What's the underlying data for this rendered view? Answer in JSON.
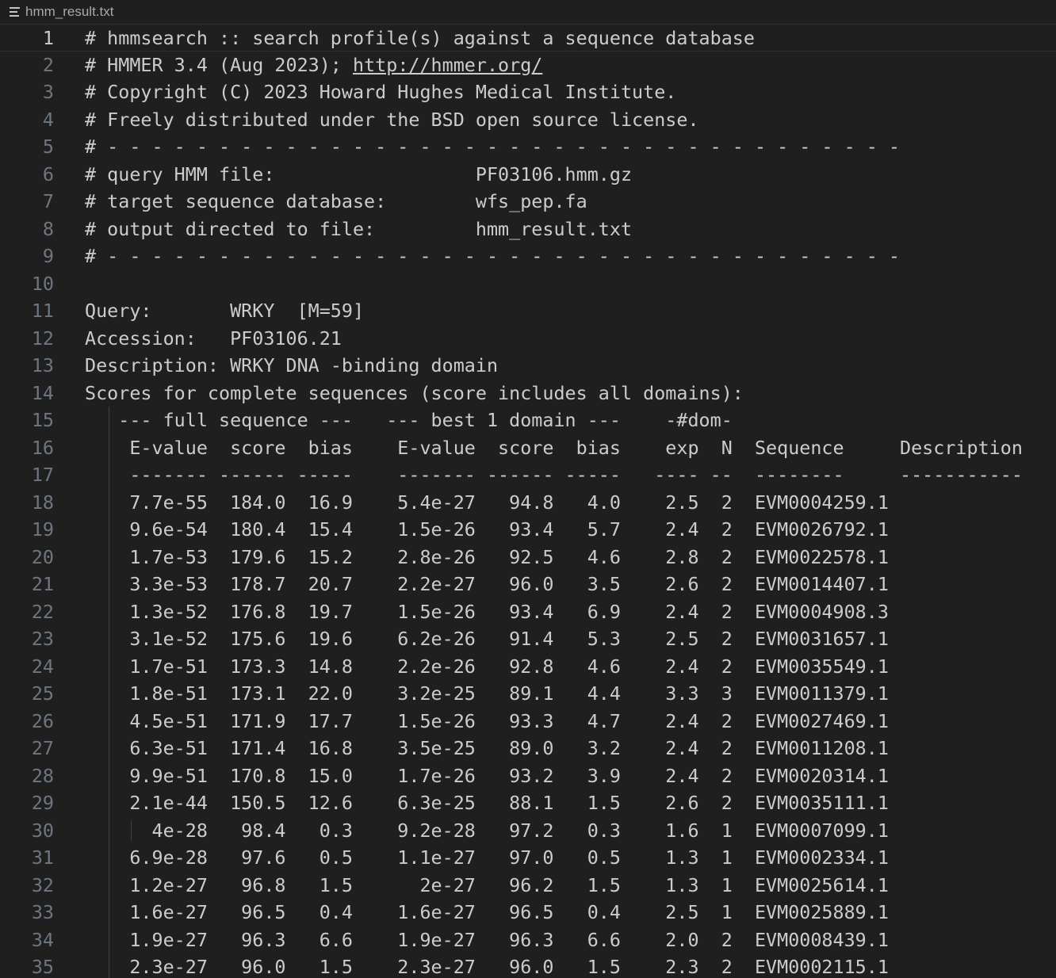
{
  "tab": {
    "filename": "hmm_result.txt",
    "icon": "file-text-icon"
  },
  "editor": {
    "current_line": 1,
    "link_text": "http://hmmer.org/",
    "lines": [
      {
        "n": "1",
        "text": "# hmmsearch :: search profile(s) against a sequence database"
      },
      {
        "n": "2",
        "text": "# HMMER 3.4 (Aug 2023); "
      },
      {
        "n": "3",
        "text": "# Copyright (C) 2023 Howard Hughes Medical Institute."
      },
      {
        "n": "4",
        "text": "# Freely distributed under the BSD open source license."
      },
      {
        "n": "5",
        "text": "# - - - - - - - - - - - - - - - - - - - - - - - - - - - - - - - - - - - -"
      },
      {
        "n": "6",
        "text": "# query HMM file:                  PF03106.hmm.gz"
      },
      {
        "n": "7",
        "text": "# target sequence database:        wfs_pep.fa"
      },
      {
        "n": "8",
        "text": "# output directed to file:         hmm_result.txt"
      },
      {
        "n": "9",
        "text": "# - - - - - - - - - - - - - - - - - - - - - - - - - - - - - - - - - - - -"
      },
      {
        "n": "10",
        "text": ""
      },
      {
        "n": "11",
        "text": "Query:       WRKY  [M=59]"
      },
      {
        "n": "12",
        "text": "Accession:   PF03106.21"
      },
      {
        "n": "13",
        "text": "Description: WRKY DNA -binding domain"
      },
      {
        "n": "14",
        "text": "Scores for complete sequences (score includes all domains):"
      },
      {
        "n": "15",
        "text": "   --- full sequence ---   --- best 1 domain ---    -#dom-"
      },
      {
        "n": "16",
        "text": "    E-value  score  bias    E-value  score  bias    exp  N  Sequence     Description"
      },
      {
        "n": "17",
        "text": "    ------- ------ -----    ------- ------ -----   ---- --  --------     -----------"
      },
      {
        "n": "18",
        "text": "    7.7e-55  184.0  16.9    5.4e-27   94.8   4.0    2.5  2  EVM0004259.1"
      },
      {
        "n": "19",
        "text": "    9.6e-54  180.4  15.4    1.5e-26   93.4   5.7    2.4  2  EVM0026792.1"
      },
      {
        "n": "20",
        "text": "    1.7e-53  179.6  15.2    2.8e-26   92.5   4.6    2.8  2  EVM0022578.1"
      },
      {
        "n": "21",
        "text": "    3.3e-53  178.7  20.7    2.2e-27   96.0   3.5    2.6  2  EVM0014407.1"
      },
      {
        "n": "22",
        "text": "    1.3e-52  176.8  19.7    1.5e-26   93.4   6.9    2.4  2  EVM0004908.3"
      },
      {
        "n": "23",
        "text": "    3.1e-52  175.6  19.6    6.2e-26   91.4   5.3    2.5  2  EVM0031657.1"
      },
      {
        "n": "24",
        "text": "    1.7e-51  173.3  14.8    2.2e-26   92.8   4.6    2.4  2  EVM0035549.1"
      },
      {
        "n": "25",
        "text": "    1.8e-51  173.1  22.0    3.2e-25   89.1   4.4    3.3  3  EVM0011379.1"
      },
      {
        "n": "26",
        "text": "    4.5e-51  171.9  17.7    1.5e-26   93.3   4.7    2.4  2  EVM0027469.1"
      },
      {
        "n": "27",
        "text": "    6.3e-51  171.4  16.8    3.5e-25   89.0   3.2    2.4  2  EVM0011208.1"
      },
      {
        "n": "28",
        "text": "    9.9e-51  170.8  15.0    1.7e-26   93.2   3.9    2.4  2  EVM0020314.1"
      },
      {
        "n": "29",
        "text": "    2.1e-44  150.5  12.6    6.3e-25   88.1   1.5    2.6  2  EVM0035111.1"
      },
      {
        "n": "30",
        "text": "      4e-28   98.4   0.3    9.2e-28   97.2   0.3    1.6  1  EVM0007099.1"
      },
      {
        "n": "31",
        "text": "    6.9e-28   97.6   0.5    1.1e-27   97.0   0.5    1.3  1  EVM0002334.1"
      },
      {
        "n": "32",
        "text": "    1.2e-27   96.8   1.5      2e-27   96.2   1.5    1.3  1  EVM0025614.1"
      },
      {
        "n": "33",
        "text": "    1.6e-27   96.5   0.4    1.6e-27   96.5   0.4    2.5  1  EVM0025889.1"
      },
      {
        "n": "34",
        "text": "    1.9e-27   96.3   6.6    1.9e-27   96.3   6.6    2.0  2  EVM0008439.1"
      },
      {
        "n": "35",
        "text": "    2.3e-27   96.0   1.5    2.3e-27   96.0   1.5    2.3  2  EVM0002115.1"
      }
    ]
  }
}
